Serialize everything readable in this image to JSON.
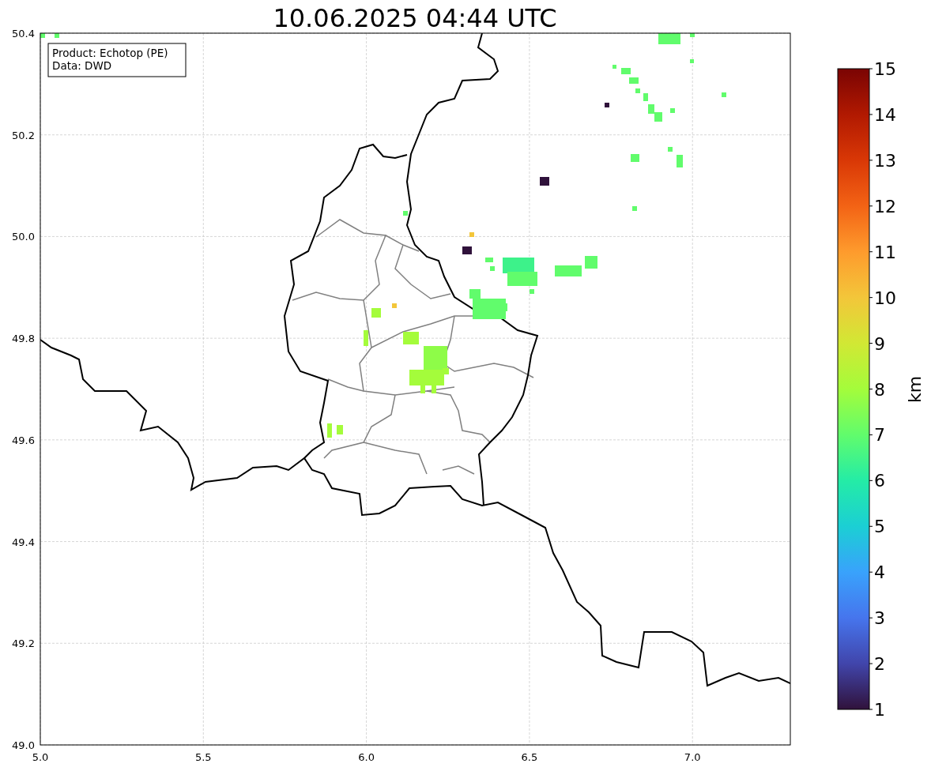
{
  "title": "10.06.2025 04:44 UTC",
  "info_box": [
    "Product: Echotop (PE)",
    "Data: DWD"
  ],
  "x_ticks": [
    "5.0",
    "5.5",
    "6.0",
    "6.5",
    "7.0"
  ],
  "y_ticks": [
    "50.4",
    "50.2",
    "50.0",
    "49.8",
    "49.6",
    "49.4",
    "49.2",
    "49.0"
  ],
  "colorbar": {
    "label": "km",
    "ticks": [
      "15",
      "14",
      "13",
      "12",
      "11",
      "10",
      "9",
      "8",
      "7",
      "6",
      "5",
      "4",
      "3",
      "2",
      "1"
    ]
  }
}
